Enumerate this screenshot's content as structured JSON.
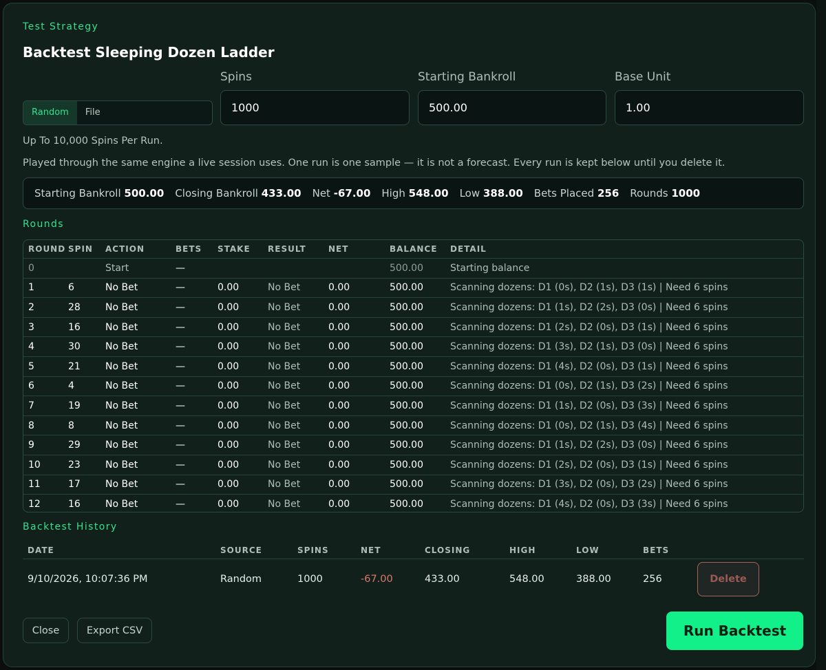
{
  "header": {
    "kicker": "Test Strategy",
    "title": "Backtest Sleeping Dozen Ladder"
  },
  "source_toggle": {
    "options": [
      "Random",
      "File"
    ],
    "selected": "Random"
  },
  "fields": {
    "spins": {
      "label": "Spins",
      "value": "1000"
    },
    "starting_bankroll": {
      "label": "Starting Bankroll",
      "value": "500.00"
    },
    "base_unit": {
      "label": "Base Unit",
      "value": "1.00"
    }
  },
  "hint": "Up To 10,000 Spins Per Run.",
  "description": "Played through the same engine a live session uses. One run is one sample — it is not a forecast. Every run is kept below until you delete it.",
  "summary": [
    {
      "label": "Starting Bankroll",
      "value": "500.00"
    },
    {
      "label": "Closing Bankroll",
      "value": "433.00"
    },
    {
      "label": "Net",
      "value": "-67.00"
    },
    {
      "label": "High",
      "value": "548.00"
    },
    {
      "label": "Low",
      "value": "388.00"
    },
    {
      "label": "Bets Placed",
      "value": "256"
    },
    {
      "label": "Rounds",
      "value": "1000"
    }
  ],
  "rounds": {
    "heading": "Rounds",
    "columns": [
      "ROUND",
      "SPIN",
      "ACTION",
      "BETS",
      "STAKE",
      "RESULT",
      "NET",
      "BALANCE",
      "DETAIL"
    ],
    "rows": [
      [
        "0",
        "",
        "Start",
        "—",
        "",
        "",
        "",
        "500.00",
        "Starting balance"
      ],
      [
        "1",
        "6",
        "No Bet",
        "—",
        "0.00",
        "No Bet",
        "0.00",
        "500.00",
        "Scanning dozens: D1 (0s), D2 (1s), D3 (1s) | Need 6 spins"
      ],
      [
        "2",
        "28",
        "No Bet",
        "—",
        "0.00",
        "No Bet",
        "0.00",
        "500.00",
        "Scanning dozens: D1 (1s), D2 (2s), D3 (0s) | Need 6 spins"
      ],
      [
        "3",
        "16",
        "No Bet",
        "—",
        "0.00",
        "No Bet",
        "0.00",
        "500.00",
        "Scanning dozens: D1 (2s), D2 (0s), D3 (1s) | Need 6 spins"
      ],
      [
        "4",
        "30",
        "No Bet",
        "—",
        "0.00",
        "No Bet",
        "0.00",
        "500.00",
        "Scanning dozens: D1 (3s), D2 (1s), D3 (0s) | Need 6 spins"
      ],
      [
        "5",
        "21",
        "No Bet",
        "—",
        "0.00",
        "No Bet",
        "0.00",
        "500.00",
        "Scanning dozens: D1 (4s), D2 (0s), D3 (1s) | Need 6 spins"
      ],
      [
        "6",
        "4",
        "No Bet",
        "—",
        "0.00",
        "No Bet",
        "0.00",
        "500.00",
        "Scanning dozens: D1 (0s), D2 (1s), D3 (2s) | Need 6 spins"
      ],
      [
        "7",
        "19",
        "No Bet",
        "—",
        "0.00",
        "No Bet",
        "0.00",
        "500.00",
        "Scanning dozens: D1 (1s), D2 (0s), D3 (3s) | Need 6 spins"
      ],
      [
        "8",
        "8",
        "No Bet",
        "—",
        "0.00",
        "No Bet",
        "0.00",
        "500.00",
        "Scanning dozens: D1 (0s), D2 (1s), D3 (4s) | Need 6 spins"
      ],
      [
        "9",
        "29",
        "No Bet",
        "—",
        "0.00",
        "No Bet",
        "0.00",
        "500.00",
        "Scanning dozens: D1 (1s), D2 (2s), D3 (0s) | Need 6 spins"
      ],
      [
        "10",
        "23",
        "No Bet",
        "—",
        "0.00",
        "No Bet",
        "0.00",
        "500.00",
        "Scanning dozens: D1 (2s), D2 (0s), D3 (1s) | Need 6 spins"
      ],
      [
        "11",
        "17",
        "No Bet",
        "—",
        "0.00",
        "No Bet",
        "0.00",
        "500.00",
        "Scanning dozens: D1 (3s), D2 (0s), D3 (2s) | Need 6 spins"
      ],
      [
        "12",
        "16",
        "No Bet",
        "—",
        "0.00",
        "No Bet",
        "0.00",
        "500.00",
        "Scanning dozens: D1 (4s), D2 (0s), D3 (3s) | Need 6 spins"
      ]
    ]
  },
  "history": {
    "heading": "Backtest History",
    "columns": [
      "DATE",
      "SOURCE",
      "SPINS",
      "NET",
      "CLOSING",
      "HIGH",
      "LOW",
      "BETS"
    ],
    "rows": [
      {
        "date": "9/10/2026, 10:07:36 PM",
        "source": "Random",
        "spins": "1000",
        "net": "-67.00",
        "closing": "433.00",
        "high": "548.00",
        "low": "388.00",
        "bets": "256",
        "action": "Delete"
      }
    ]
  },
  "footer": {
    "close_label": "Close",
    "export_label": "Export CSV",
    "run_label": "Run Backtest"
  },
  "colors": {
    "accent": "#35e08c",
    "primary_button": "#12f08a",
    "negative": "#d9796d",
    "panel": "#11201b"
  }
}
